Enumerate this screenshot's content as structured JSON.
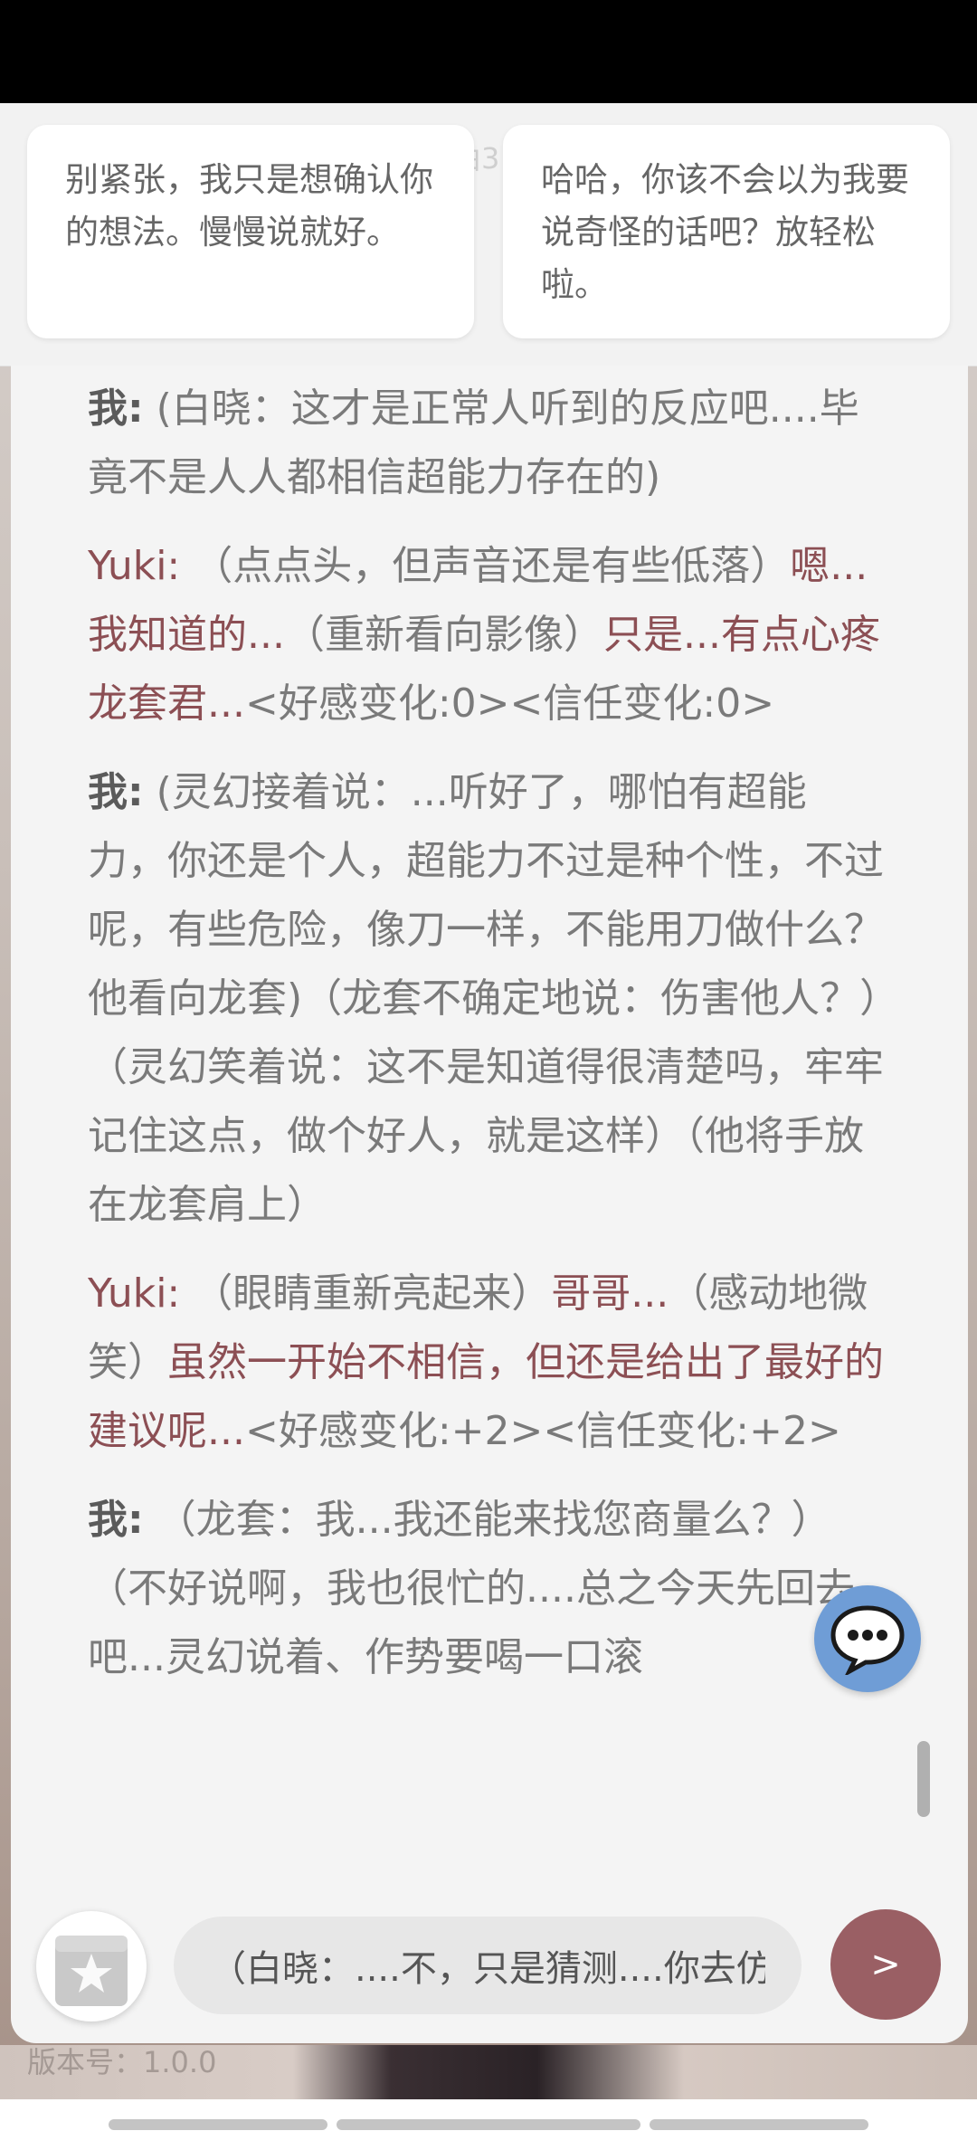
{
  "background": {
    "accent": "#9a5f64"
  },
  "suggestions": [
    {
      "text": "别紧张，我只是想确认你的想法。慢慢说就好。"
    },
    {
      "text": "哈哈，你该不会以为我要说奇怪的话吧？放轻松啦。"
    }
  ],
  "header": {
    "ghost_text": "由3"
  },
  "messages": [
    {
      "speaker": "我:",
      "parts": [
        {
          "text": " (白晓：这才是正常人听到的反应吧....毕竟不是人人都相信超能力存在的)",
          "style": "narration"
        }
      ]
    },
    {
      "speaker": "Yuki:",
      "parts": [
        {
          "text": " （点点头，但声音还是有些低落）",
          "style": "narration"
        },
        {
          "text": "嗯...我知道的...",
          "style": "speech"
        },
        {
          "text": "（重新看向影像）",
          "style": "narration"
        },
        {
          "text": "只是...有点心疼龙套君...",
          "style": "speech"
        },
        {
          "text": "<好感变化:0><信任变化:0>",
          "style": "narration"
        }
      ]
    },
    {
      "speaker": "我:",
      "parts": [
        {
          "text": " (灵幻接着说：...听好了，哪怕有超能力，你还是个人，超能力不过是种个性，不过呢，有些危险，像刀一样，不能用刀做什么？他看向龙套)（龙套不确定地说：伤害他人？）（灵幻笑着说：这不是知道得很清楚吗，牢牢记住这点，做个好人，就是这样）（他将手放在龙套肩上）",
          "style": "narration"
        }
      ]
    },
    {
      "speaker": "Yuki:",
      "parts": [
        {
          "text": " （眼睛重新亮起来）",
          "style": "narration"
        },
        {
          "text": "哥哥...",
          "style": "speech"
        },
        {
          "text": "（感动地微笑）",
          "style": "narration"
        },
        {
          "text": "虽然一开始不相信，但还是给出了最好的建议呢...",
          "style": "speech"
        },
        {
          "text": "<好感变化:+2><信任变化:+2>",
          "style": "narration"
        }
      ]
    },
    {
      "speaker": "我:",
      "parts": [
        {
          "text": " （龙套：我...我还能来找您商量么？）（不好说啊，我也很忙的....总之今天先回去吧...灵幻说着、作势要喝一口滚",
          "style": "narration"
        }
      ]
    }
  ],
  "input": {
    "value": "（白晓：....不，只是猜测....你去仿"
  },
  "send": {
    "label": ">"
  },
  "footer": {
    "version": "版本号：1.0.0"
  },
  "icons": {
    "chat": "speech-bubble-icon",
    "gift": "gift-star-icon"
  }
}
